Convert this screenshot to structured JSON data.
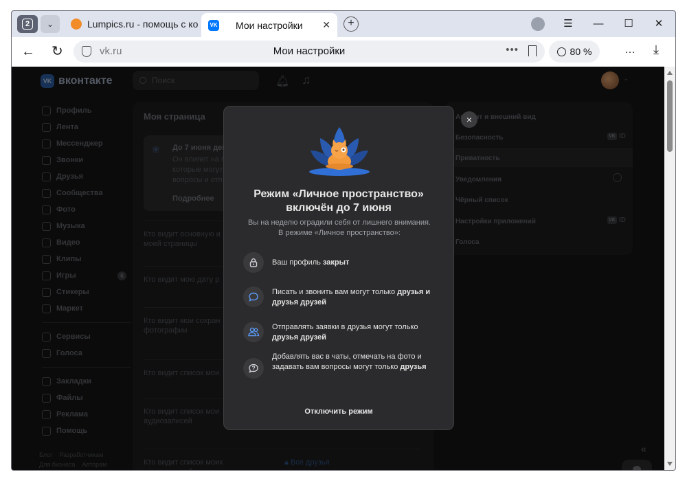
{
  "browser": {
    "tab_count": "2",
    "tabs": [
      {
        "title": "Lumpics.ru - помощь с ком",
        "favicon": "lumpics-orange-circle"
      },
      {
        "title": "Мои настройки",
        "favicon": "vk-icon"
      }
    ],
    "address": {
      "host": "vk.ru",
      "page_title": "Мои настройки",
      "zoom": "80 %"
    }
  },
  "vk": {
    "logo_text": "вконтакте",
    "search_placeholder": "Поиск",
    "nav": [
      {
        "label": "Профиль",
        "icon": "profile-icon"
      },
      {
        "label": "Лента",
        "icon": "feed-icon"
      },
      {
        "label": "Мессенджер",
        "icon": "messenger-icon"
      },
      {
        "label": "Звонки",
        "icon": "phone-icon"
      },
      {
        "label": "Друзья",
        "icon": "friends-icon"
      },
      {
        "label": "Сообщества",
        "icon": "communities-icon"
      },
      {
        "label": "Фото",
        "icon": "photo-icon"
      },
      {
        "label": "Музыка",
        "icon": "music-icon"
      },
      {
        "label": "Видео",
        "icon": "video-icon"
      },
      {
        "label": "Клипы",
        "icon": "clips-icon"
      },
      {
        "label": "Игры",
        "icon": "games-icon",
        "badge": "6"
      },
      {
        "label": "Стикеры",
        "icon": "stickers-icon"
      },
      {
        "label": "Маркет",
        "icon": "market-icon"
      }
    ],
    "nav2": [
      {
        "label": "Сервисы",
        "icon": "services-icon"
      },
      {
        "label": "Голоса",
        "icon": "votes-icon"
      }
    ],
    "nav3": [
      {
        "label": "Закладки",
        "icon": "bookmarks-icon"
      },
      {
        "label": "Файлы",
        "icon": "files-icon"
      },
      {
        "label": "Реклама",
        "icon": "ads-icon"
      },
      {
        "label": "Помощь",
        "icon": "help-icon"
      }
    ],
    "footer": [
      "Блог",
      "Разработчикам",
      "Для бизнеса",
      "Авторам"
    ],
    "center": {
      "title": "Моя страница",
      "notice_title": "До 7 июня дей",
      "notice_desc": "Он влияет на п которые могут вопросы и отп",
      "notice_more": "Подробнее",
      "rows": [
        {
          "label": "Кто видит основную и моей страницы"
        },
        {
          "label": "Кто видит мою дату р"
        },
        {
          "label": "Кто видит мои сохран фотографии"
        },
        {
          "label": "Кто видит список мои"
        },
        {
          "label": "Кто видит список мои аудиозаписей"
        },
        {
          "label": "Кто видит список моих видеозаписей",
          "value": "Все друзья"
        }
      ]
    },
    "right_menu": [
      {
        "label": "Аккаунт и внешний вид"
      },
      {
        "label": "Безопасность",
        "tag": "ID"
      },
      {
        "label": "Приватность"
      },
      {
        "label": "Уведомления",
        "gear": true
      },
      {
        "label": "Чёрный список"
      },
      {
        "label": "Настройки приложений",
        "tag": "ID"
      },
      {
        "label": "Голоса"
      }
    ]
  },
  "modal": {
    "title_line1": "Режим «Личное пространство»",
    "title_line2": "включён до 7 июня",
    "subtitle_line1": "Вы на неделю оградили себя от лишнего внимания.",
    "subtitle_line2": "В режиме «Личное пространство»:",
    "features": [
      {
        "icon": "lock-icon",
        "text": "Ваш профиль ",
        "bold": "закрыт"
      },
      {
        "icon": "chat-icon",
        "text": "Писать и звонить вам могут только ",
        "bold": "друзья и друзья друзей"
      },
      {
        "icon": "friends-icon",
        "text": "Отправлять заявки в друзья могут только ",
        "bold": "друзья друзей"
      },
      {
        "icon": "question-icon",
        "text": "Добавлять вас в чаты, отмечать на фото и задавать вам вопросы могут только ",
        "bold": "друзья"
      }
    ],
    "off_button": "Отключить режим",
    "close": "×"
  },
  "colors": {
    "accent": "#4a8cf7",
    "modal_bg": "#2b2b2d",
    "page_bg": "#141414"
  }
}
